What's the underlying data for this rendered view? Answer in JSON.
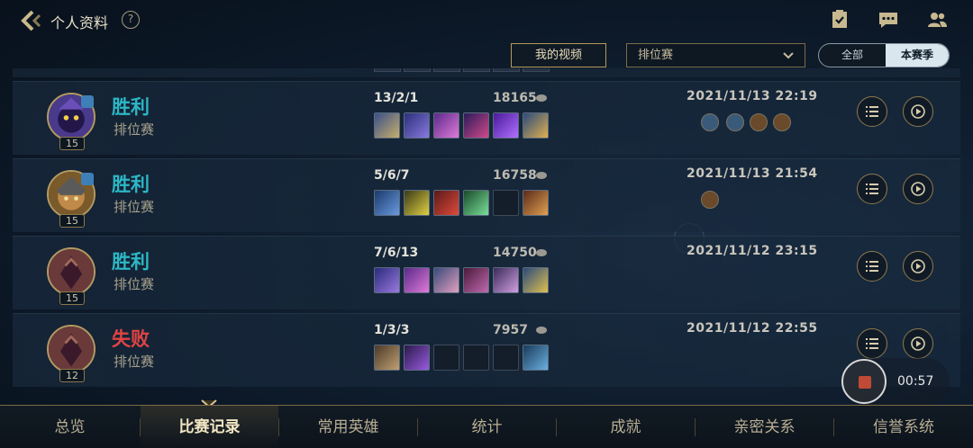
{
  "header": {
    "title": "个人资料",
    "help_label": "?"
  },
  "filters": {
    "video_button": "我的视频",
    "mode_select": "排位赛",
    "scope_all": "全部",
    "scope_season": "本赛季"
  },
  "matches": [
    {
      "result": "胜利",
      "mode": "排位赛",
      "level": "15",
      "kda": "13/2/1",
      "gold": "18165",
      "datetime": "2021/11/13 22:19"
    },
    {
      "result": "胜利",
      "mode": "排位赛",
      "level": "15",
      "kda": "5/6/7",
      "gold": "16758",
      "datetime": "2021/11/13 21:54"
    },
    {
      "result": "胜利",
      "mode": "排位赛",
      "level": "15",
      "kda": "7/6/13",
      "gold": "14750",
      "datetime": "2021/11/12 23:15"
    },
    {
      "result": "失败",
      "mode": "排位赛",
      "level": "12",
      "kda": "1/3/3",
      "gold": "7957",
      "datetime": "2021/11/12 22:55"
    }
  ],
  "recording": {
    "elapsed": "00:57"
  },
  "nav": {
    "items": [
      "总览",
      "比赛记录",
      "常用英雄",
      "统计",
      "成就",
      "亲密关系",
      "信誉系统"
    ],
    "active": "比赛记录"
  },
  "colors": {
    "win": "#2cb7c6",
    "lose": "#e04444",
    "gold_accent": "#b59a5a"
  }
}
